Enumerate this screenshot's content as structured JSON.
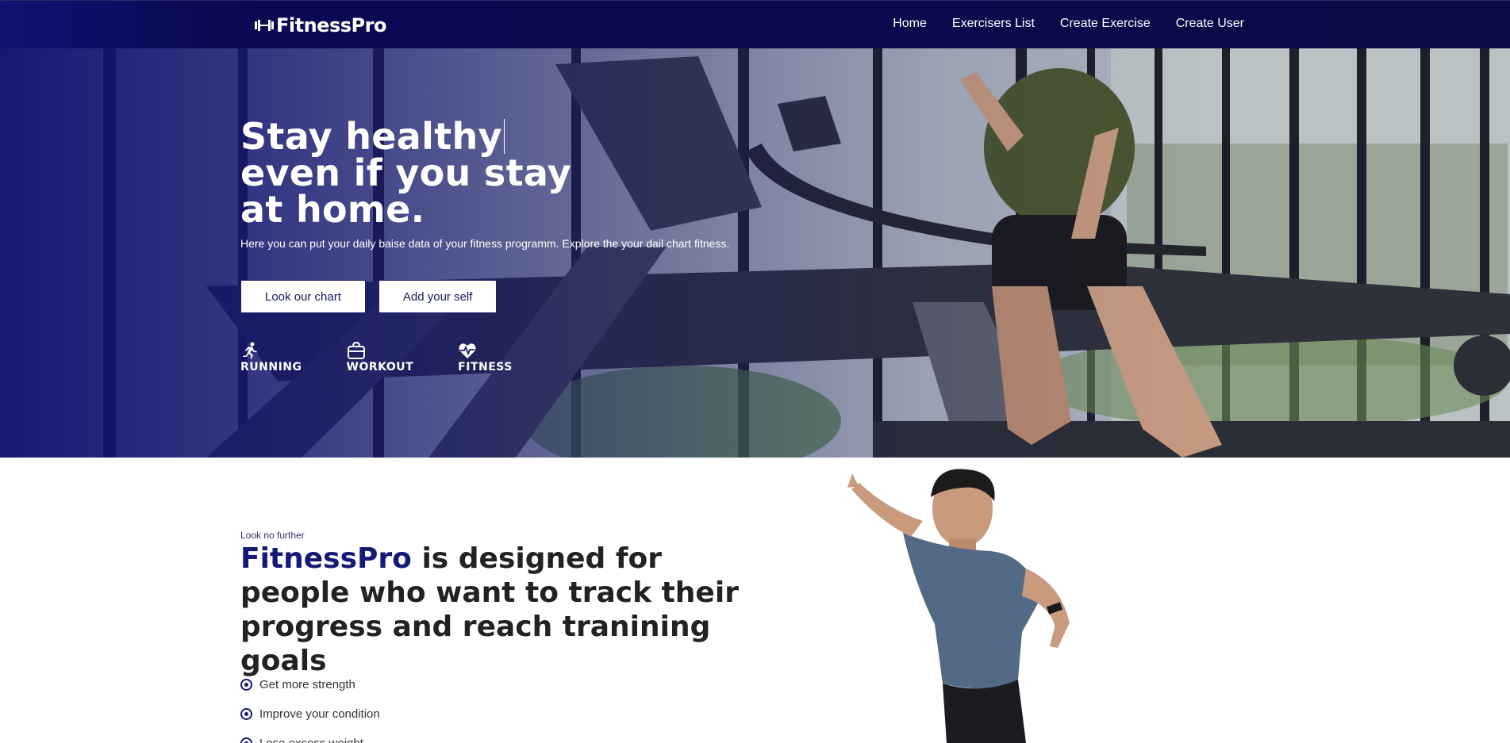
{
  "navbar": {
    "logo_text": "FitnessPro",
    "logo_icon": "dumbbell-icon",
    "links": [
      {
        "label": "Home"
      },
      {
        "label": "Exercisers List"
      },
      {
        "label": "Create Exercise"
      },
      {
        "label": "Create User"
      }
    ]
  },
  "hero": {
    "title_lines": [
      "Stay healthy",
      "even if you stay",
      "at home."
    ],
    "subtitle": "Here you can put your daily baise data of your fitness programm. Explore the your dail chart fitness.",
    "buttons": [
      {
        "label": "Look our chart"
      },
      {
        "label": "Add your self"
      }
    ],
    "features": [
      {
        "label": "RUNNING",
        "icon": "running-person-icon"
      },
      {
        "label": "WORKOUT",
        "icon": "gym-bag-icon"
      },
      {
        "label": "FITNESS",
        "icon": "heart-pulse-icon"
      }
    ]
  },
  "about": {
    "eyebrow": "Look no further",
    "title_brand": "FitnessPro",
    "title_rest": " is designed for people who want to track their progress and reach tranining goals",
    "checklist": [
      {
        "label": "Get more strength"
      },
      {
        "label": "Improve your condition"
      },
      {
        "label": "Lose excess weight"
      }
    ]
  },
  "colors": {
    "navbar": "#0a0a45",
    "brand": "#151a78",
    "hero_overlay": "#141673",
    "heading_text": "#222222"
  }
}
